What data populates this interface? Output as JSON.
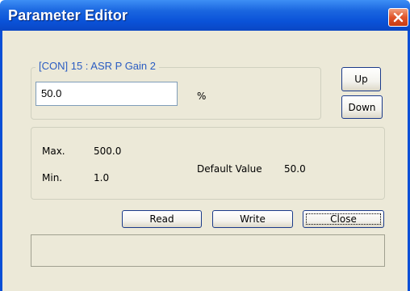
{
  "window": {
    "title": "Parameter Editor",
    "close_icon": "close-icon"
  },
  "parameter": {
    "group_label": "[CON] 15 : ASR P Gain 2",
    "value": "50.0",
    "unit": "%"
  },
  "nav": {
    "up_label": "Up",
    "down_label": "Down"
  },
  "info": {
    "max_label": "Max.",
    "max_value": "500.0",
    "min_label": "Min.",
    "min_value": "1.0",
    "default_label": "Default Value",
    "default_value": "50.0"
  },
  "actions": {
    "read_label": "Read",
    "write_label": "Write",
    "close_label": "Close"
  },
  "status": {
    "text": ""
  },
  "colors": {
    "titlebar": "#0a52d8",
    "close_button": "#e0542a",
    "group_label": "#2a5cc2",
    "dialog_bg": "#ece9d8"
  }
}
